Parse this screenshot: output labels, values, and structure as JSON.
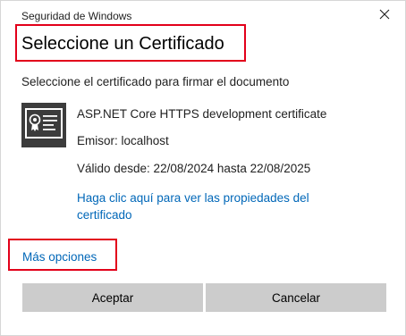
{
  "window": {
    "title": "Seguridad de Windows"
  },
  "dialog": {
    "heading": "Seleccione un Certificado",
    "subheading": "Seleccione el certificado para firmar el documento",
    "more_options": "Más opciones"
  },
  "certificate": {
    "name": "ASP.NET Core HTTPS development certificate",
    "issuer": "Emisor: localhost",
    "validity": "Válido desde: 22/08/2024 hasta 22/08/2025",
    "properties_link": "Haga clic aquí para ver las propiedades del certificado",
    "icon": "certificate-icon"
  },
  "buttons": {
    "accept": "Aceptar",
    "cancel": "Cancelar"
  },
  "colors": {
    "link": "#0067b8",
    "highlight_box": "#e2001a",
    "button_bg": "#cccccc"
  }
}
